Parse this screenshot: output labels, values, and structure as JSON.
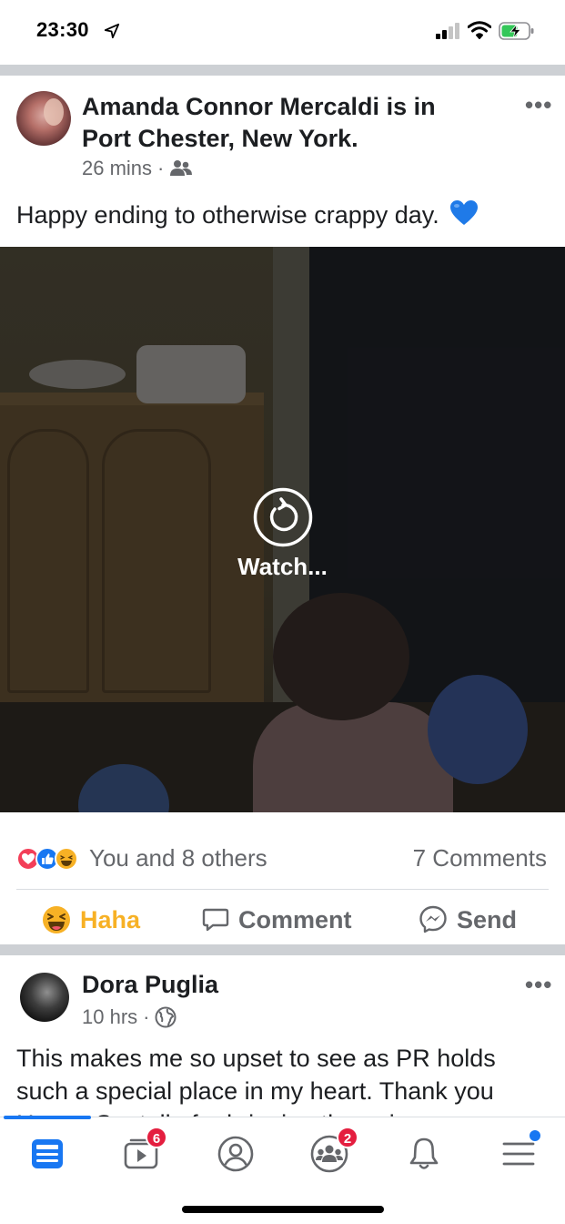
{
  "status_bar": {
    "time": "23:30"
  },
  "post1": {
    "author": "Amanda Connor Mercaldi",
    "location_phrase": "is in",
    "location": "Port Chester, New York.",
    "time": "26 mins",
    "separator": "·",
    "text": "Happy ending to otherwise crappy day.",
    "video": {
      "label": "Watch..."
    },
    "reactions_summary": "You and 8 others",
    "comments_count": "7 Comments",
    "actions": {
      "haha": "Haha",
      "comment": "Comment",
      "send": "Send"
    }
  },
  "post2": {
    "author": "Dora Puglia",
    "time": "10 hrs",
    "separator": "·",
    "text": "This makes me so upset to see as PR holds such a special place in my heart. Thank you Hector Santella for bringing the pain"
  },
  "tab_bar": {
    "watch_badge": "6",
    "groups_badge": "2"
  },
  "colors": {
    "accent": "#1877f2",
    "badge": "#e41e3f",
    "haha": "#f7b125",
    "secondary_text": "#65676b"
  }
}
